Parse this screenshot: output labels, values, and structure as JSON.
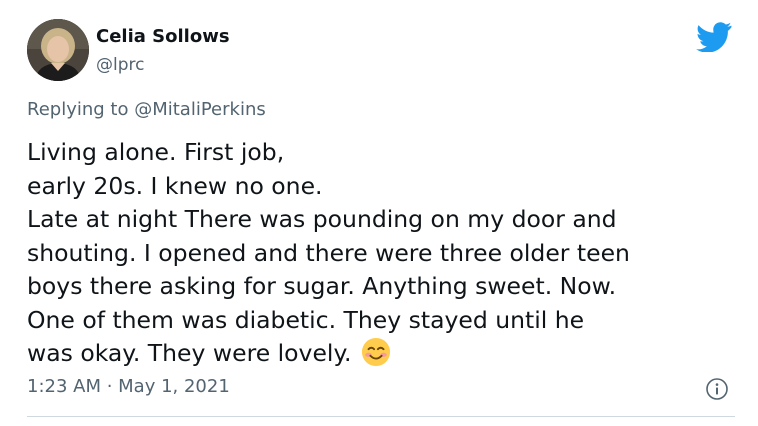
{
  "tweet": {
    "author": {
      "display_name": "Celia Sollows",
      "handle": "@lprc"
    },
    "reply": {
      "prefix": "Replying to",
      "mention": "@MitaliPerkins"
    },
    "body_lines": [
      "Living alone. First job,",
      "early 20s. I knew no one.",
      "Late at night There was pounding on my door and",
      "shouting. I opened and there were three older teen",
      "boys there asking for sugar. Anything sweet. Now.",
      "One of them was diabetic. They stayed until he",
      "was okay. They were lovely."
    ],
    "emoji": "smiling-face-with-smiling-eyes",
    "timestamp": "1:23 AM · May 1, 2021",
    "icons": {
      "logo": "twitter-bird-icon",
      "info": "info-icon"
    },
    "colors": {
      "brand": "#1d9bf0",
      "secondary_text": "#536471",
      "primary_text": "#0f1419"
    }
  }
}
